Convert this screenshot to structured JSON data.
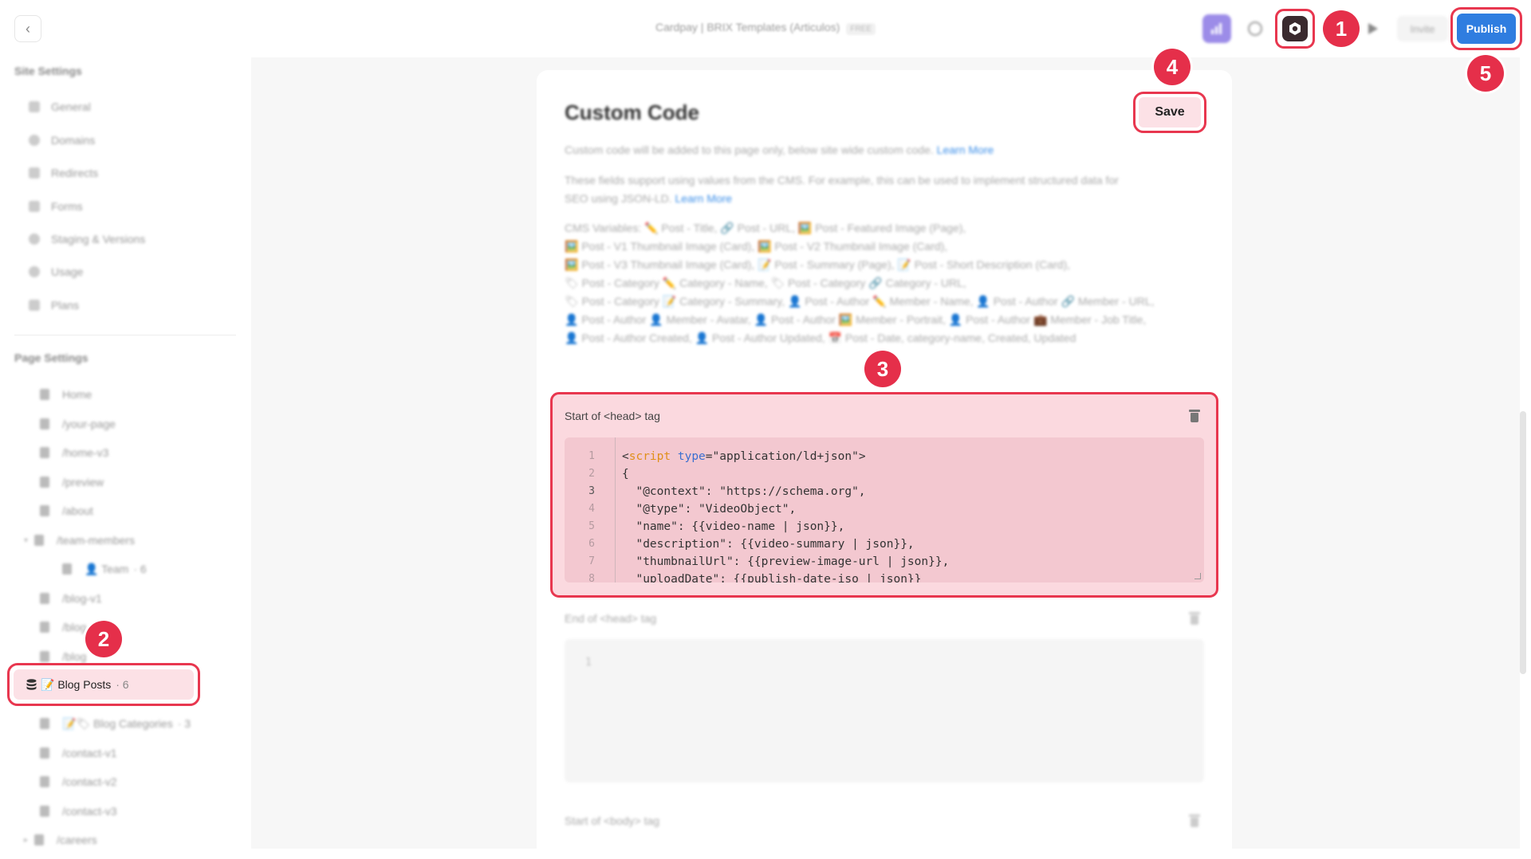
{
  "topbar": {
    "title": "Cardpay | BRIX Templates (Articulos)",
    "badge": "FREE",
    "invite_label": "Invite",
    "publish_label": "Publish"
  },
  "markers": [
    "1",
    "2",
    "3",
    "4",
    "5"
  ],
  "sidebar": {
    "site_heading": "Site Settings",
    "site_items": [
      "General",
      "Domains",
      "Redirects",
      "Forms",
      "Staging & Versions",
      "Usage",
      "Plans"
    ],
    "page_heading": "Page Settings",
    "pages": [
      {
        "label": "Home"
      },
      {
        "label": "/your-page"
      },
      {
        "label": "/home-v3"
      },
      {
        "label": "/preview"
      },
      {
        "label": "/about"
      },
      {
        "label": "/team-members"
      },
      {
        "label": "👤 Team",
        "count": "· 6"
      },
      {
        "label": "/blog-v1"
      },
      {
        "label": "/blog"
      },
      {
        "label": "/blog"
      },
      {
        "label": "📝 Blog Posts",
        "count": "· 6"
      },
      {
        "label": "📝🏷 Blog Categories",
        "count": "· 3"
      },
      {
        "label": "/contact-v1"
      },
      {
        "label": "/contact-v2"
      },
      {
        "label": "/contact-v3"
      },
      {
        "label": "/careers"
      }
    ]
  },
  "main": {
    "title": "Custom Code",
    "save_label": "Save",
    "desc1": "Custom code will be added to this page only, below site wide custom code.",
    "learn_more": "Learn More",
    "desc2a": "These fields support using values from the CMS. For example, this can be used to implement structured data for",
    "desc2b": "SEO using JSON-LD.",
    "cms_lines": [
      "CMS Variables: ✏️ Post - Title, 🔗 Post - URL, 🖼️ Post - Featured Image (Page),",
      "🖼️ Post - V1 Thumbnail Image (Card), 🖼️ Post - V2 Thumbnail Image (Card),",
      "🖼️ Post - V3 Thumbnail Image (Card), 📝 Post - Summary (Page), 📝 Post - Short Description (Card),",
      "🏷 Post - Category ✏️ Category - Name, 🏷 Post - Category 🔗 Category - URL,",
      "🏷 Post - Category 📝 Category - Summary, 👤 Post - Author ✏️ Member - Name, 👤 Post - Author 🔗 Member - URL,",
      "👤 Post - Author 👤 Member - Avatar, 👤 Post - Author 🖼️ Member - Portrait, 👤 Post - Author 💼 Member - Job Title,",
      "👤 Post - Author Created, 👤 Post - Author Updated, 📅 Post - Date, category-name, Created, Updated"
    ],
    "head_start_label": "Start of <head> tag",
    "code_lines": [
      {
        "n": "1",
        "pre": "<",
        "kw": "script",
        "sp": " ",
        "at": "type",
        "post": "=\"application/ld+json\">"
      },
      {
        "n": "2",
        "text": "{"
      },
      {
        "n": "3",
        "text": "  \"@context\": \"https://schema.org\","
      },
      {
        "n": "4",
        "text": "  \"@type\": \"VideoObject\","
      },
      {
        "n": "5",
        "text": "  \"name\": {{video-name | json}},"
      },
      {
        "n": "6",
        "text": "  \"description\": {{video-summary | json}},"
      },
      {
        "n": "7",
        "text": "  \"thumbnailUrl\": {{preview-image-url | json}},"
      },
      {
        "n": "8",
        "text": "  \"uploadDate\": {{publish-date-iso | json}}"
      }
    ],
    "head_end_label": "End of <head> tag",
    "head_end_line": "1",
    "body_start_label": "Start of <body> tag"
  }
}
